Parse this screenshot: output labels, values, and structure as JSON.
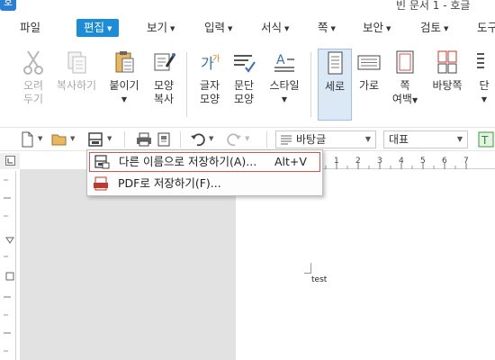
{
  "window": {
    "title": "빈 문서 1 - 호글"
  },
  "menu": {
    "items": [
      {
        "label": "파일"
      },
      {
        "label": "편집"
      },
      {
        "label": "보기"
      },
      {
        "label": "입력"
      },
      {
        "label": "서식"
      },
      {
        "label": "쪽"
      },
      {
        "label": "보안"
      },
      {
        "label": "검토"
      },
      {
        "label": "도구"
      }
    ]
  },
  "ribbon": {
    "cut": {
      "line1": "오려",
      "line2": "두기"
    },
    "copy": {
      "line1": "복사하기"
    },
    "paste": {
      "line1": "붙이기"
    },
    "format_copy": {
      "line1": "모양",
      "line2": "복사"
    },
    "char_shape": {
      "line1": "글자",
      "line2": "모양"
    },
    "para_shape": {
      "line1": "문단",
      "line2": "모양"
    },
    "style": {
      "line1": "스타일"
    },
    "portrait": {
      "line1": "세로"
    },
    "landscape": {
      "line1": "가로"
    },
    "margin": {
      "line1": "쪽",
      "line2": "여백"
    },
    "background": {
      "line1": "바탕쪽"
    },
    "columns": {
      "line1": "단"
    }
  },
  "toolbar": {
    "style_combo": "바탕글",
    "font_combo": "대표"
  },
  "save_menu": {
    "items": [
      {
        "label": "다른 이름으로 저장하기(A)...",
        "shortcut": "Alt+V"
      },
      {
        "label": "PDF로 저장하기(F)..."
      }
    ]
  },
  "document": {
    "body_text": "test"
  },
  "ruler": {
    "h_marks": [
      "1",
      "2",
      "3",
      "4",
      "5",
      "6",
      "7"
    ]
  },
  "colors": {
    "accent": "#1a8cd8",
    "highlight_border": "#d9534f"
  }
}
